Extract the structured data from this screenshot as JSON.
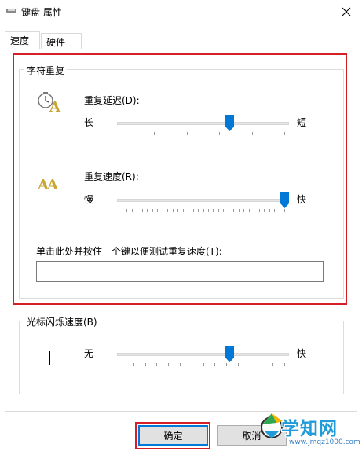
{
  "window": {
    "title": "键盘 属性",
    "close_icon": "close-icon"
  },
  "tabs": [
    {
      "label": "速度",
      "active": true
    },
    {
      "label": "硬件",
      "active": false
    }
  ],
  "char_repeat": {
    "legend": "字符重复",
    "delay": {
      "label": "重复延迟(D):",
      "min_label": "长",
      "max_label": "短",
      "icon": "clock-letter-icon",
      "value_fraction": 0.66
    },
    "rate": {
      "label": "重复速度(R):",
      "min_label": "慢",
      "max_label": "快",
      "icon": "double-letter-icon",
      "value_fraction": 1.0
    },
    "test": {
      "label": "单击此处并按住一个键以便测试重复速度(T):",
      "value": ""
    }
  },
  "cursor_blink": {
    "legend": "光标闪烁速度(B)",
    "min_label": "无",
    "max_label": "快",
    "value_fraction": 0.66
  },
  "buttons": {
    "ok": "确定",
    "cancel": "取消"
  },
  "watermark": {
    "title": "学知网",
    "url": "www.jmqz1000.com"
  },
  "colors": {
    "highlight": "#d61f26",
    "slider_thumb": "#0078d7",
    "watermark_blue": "#1f9cd8"
  }
}
